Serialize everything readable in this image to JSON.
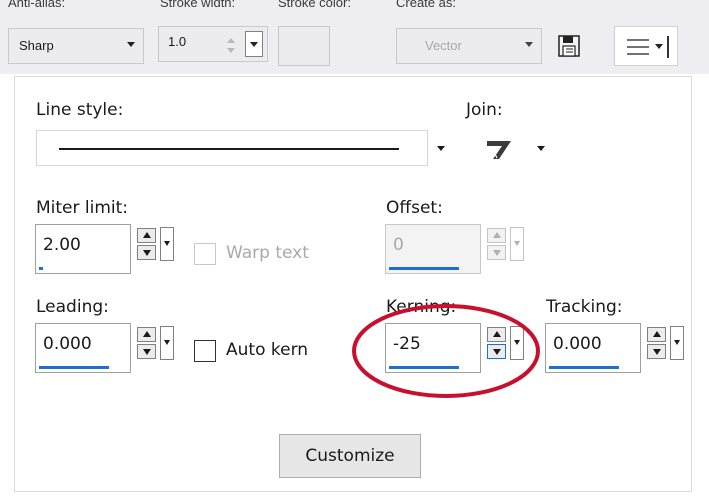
{
  "toolbar": {
    "anti_alias": {
      "label": "Anti-alias:",
      "value": "Sharp"
    },
    "stroke_width": {
      "label": "Stroke width:",
      "value": "1.0"
    },
    "stroke_color": {
      "label": "Stroke color:"
    },
    "create_as": {
      "label": "Create as:",
      "value": "Vector"
    },
    "icons": [
      "save-preset-icon",
      "menu-icon"
    ]
  },
  "dialog": {
    "line_style": {
      "label": "Line style:"
    },
    "join": {
      "label": "Join:",
      "icon": "miter-join-icon"
    },
    "miter_limit": {
      "label": "Miter limit:",
      "value": "2.00"
    },
    "warp_text": {
      "label": "Warp text",
      "checked": false,
      "enabled": false
    },
    "offset": {
      "label": "Offset:",
      "value": "0",
      "enabled": false
    },
    "leading": {
      "label": "Leading:",
      "value": "0.000"
    },
    "auto_kern": {
      "label": "Auto kern",
      "checked": false
    },
    "kerning": {
      "label": "Kerning:",
      "value": "-25"
    },
    "tracking": {
      "label": "Tracking:",
      "value": "0.000"
    },
    "customize_button": "Customize"
  },
  "colors": {
    "accent": "#1f6fd1",
    "highlight_ring": "#c8102e"
  }
}
